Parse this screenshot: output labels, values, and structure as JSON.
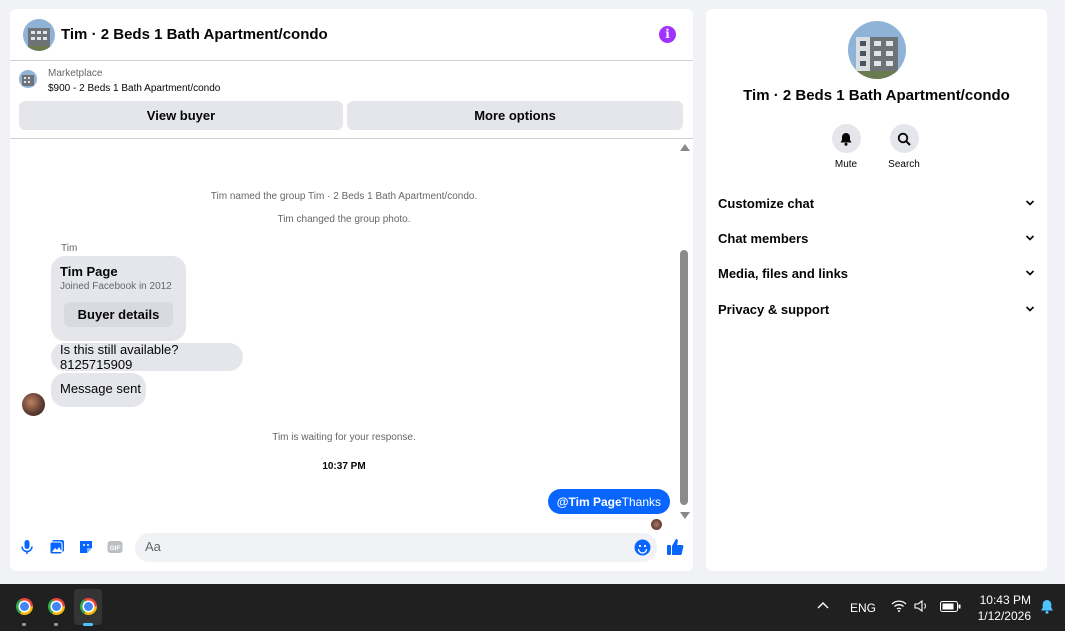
{
  "header": {
    "title": "Tim · 2 Beds 1 Bath Apartment/condo",
    "info_icon": "info-icon"
  },
  "marketplace": {
    "label": "Marketplace",
    "listing": "$900 - 2 Beds 1 Bath Apartment/condo",
    "view_buyer": "View buyer",
    "more_options": "More options"
  },
  "messages": {
    "sys1": "Tim named the group Tim · 2 Beds 1 Bath Apartment/condo.",
    "sys2": "Tim changed the group photo.",
    "sender": "Tim",
    "card_name": "Tim Page",
    "card_sub": "Joined Facebook in 2012",
    "card_button": "Buyer details",
    "msg1": "Is this still available? 8125715909",
    "msg2": "Message sent",
    "sys3": "Tim is waiting for your response.",
    "time": "10:37 PM",
    "out_mention": "@Tim Page",
    "out_text": "Thanks"
  },
  "composer": {
    "placeholder": "Aa"
  },
  "info": {
    "title": "Tim · 2 Beds 1 Bath Apartment/condo",
    "mute": "Mute",
    "search": "Search",
    "rows": [
      "Customize chat",
      "Chat members",
      "Media, files and links",
      "Privacy & support"
    ]
  },
  "taskbar": {
    "lang": "ENG",
    "time": "10:43 PM",
    "date": "1/12/2026"
  },
  "colors": {
    "accent": "#0866ff",
    "info": "#a033ff",
    "bubble": "#e4e6eb"
  }
}
